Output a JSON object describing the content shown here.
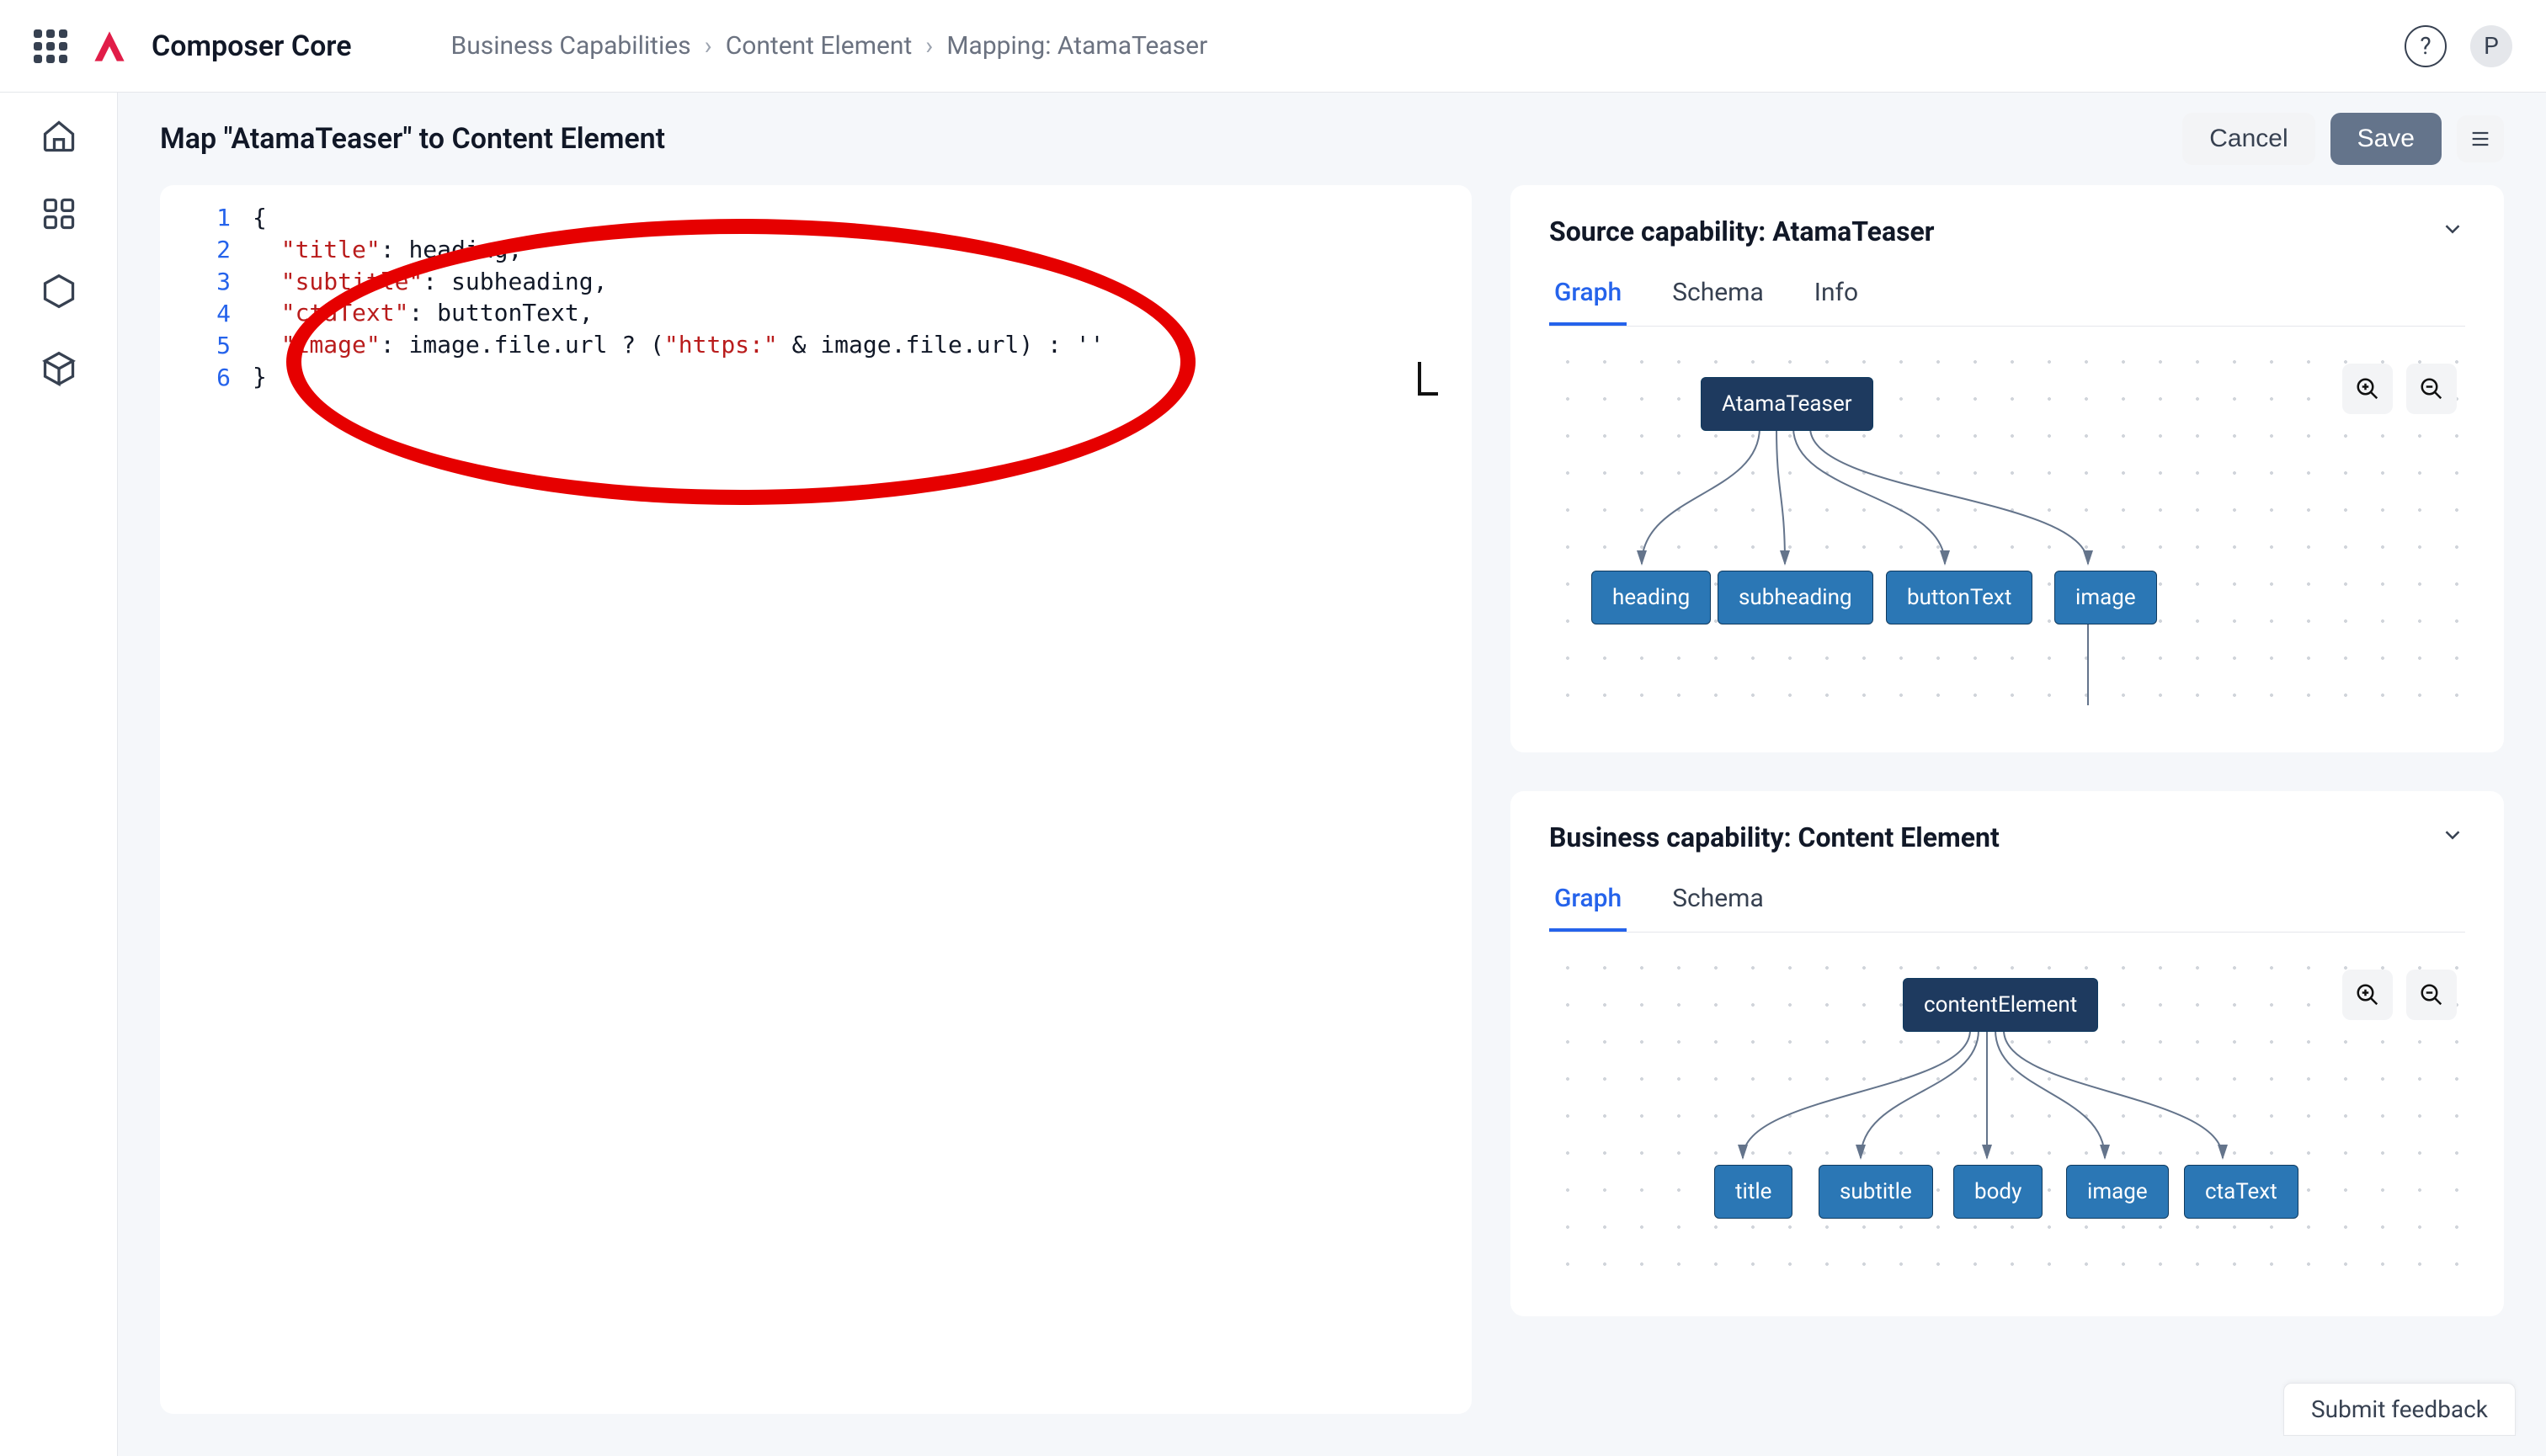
{
  "app": {
    "name": "Composer Core"
  },
  "breadcrumbs": {
    "a": "Business Capabilities",
    "b": "Content Element",
    "c": "Mapping: AtamaTeaser"
  },
  "user": {
    "initial": "P",
    "help_tooltip": "?"
  },
  "page": {
    "title": "Map \"AtamaTeaser\"  to Content Element",
    "cancel": "Cancel",
    "save": "Save"
  },
  "editor": {
    "line_numbers": [
      "1",
      "2",
      "3",
      "4",
      "5",
      "6"
    ],
    "code": {
      "l1": "{",
      "l2_key": "\"title\"",
      "l2_rest": ": heading,",
      "l3_key": "\"subtitle\"",
      "l3_rest": ": subheading,",
      "l4_key": "\"ctaText\"",
      "l4_rest": ": buttonText,",
      "l5_key": "\"image\"",
      "l5_mid": ": image.file.url ? (",
      "l5_str": "\"https:\"",
      "l5_end": " & image.file.url) : ''",
      "l6": "}"
    },
    "raw": "{\n  \"title\": heading,\n  \"subtitle\": subheading,\n  \"ctaText\": buttonText,\n  \"image\": image.file.url ? (\"https:\" & image.file.url) : ''\n}"
  },
  "source_panel": {
    "title": "Source capability: AtamaTeaser",
    "tabs": {
      "graph": "Graph",
      "schema": "Schema",
      "info": "Info"
    },
    "graph": {
      "root": "AtamaTeaser",
      "children": [
        "heading",
        "subheading",
        "buttonText",
        "image"
      ]
    }
  },
  "business_panel": {
    "title": "Business capability: Content Element",
    "tabs": {
      "graph": "Graph",
      "schema": "Schema"
    },
    "graph": {
      "root": "contentElement",
      "children": [
        "title",
        "subtitle",
        "body",
        "image",
        "ctaText"
      ]
    }
  },
  "feedback": {
    "label": "Submit feedback"
  },
  "icons": {
    "apps": "apps-grid-icon",
    "home": "home-icon",
    "capabilities": "capabilities-icon",
    "hex": "hexagon-icon",
    "cube": "cube-icon",
    "help": "help-icon",
    "menu": "menu-icon",
    "chevron_down": "chevron-down-icon",
    "zoom_in": "zoom-in-icon",
    "zoom_out": "zoom-out-icon"
  }
}
